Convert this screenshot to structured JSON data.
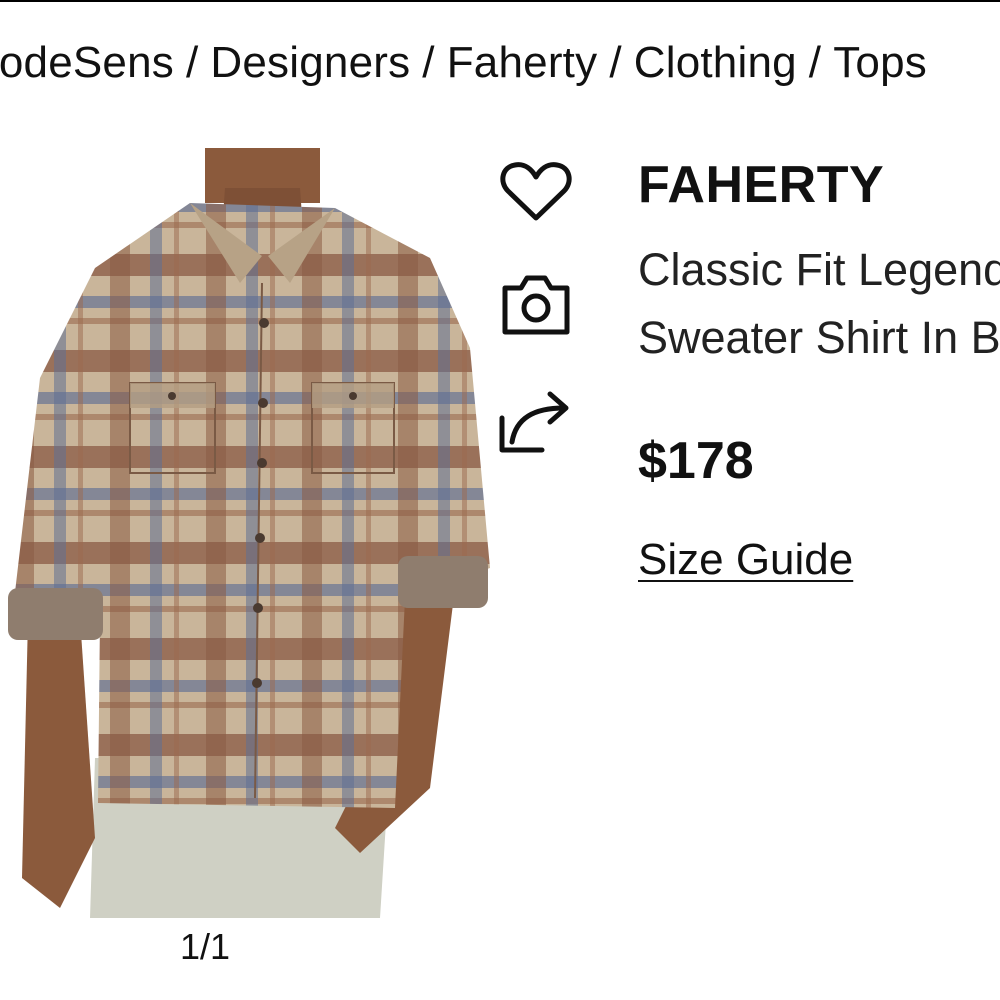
{
  "breadcrumb": {
    "items": [
      "ModeSens",
      "Designers",
      "Faherty",
      "Clothing",
      "Tops"
    ],
    "separator": "/"
  },
  "product": {
    "brand": "FAHERTY",
    "name_line1": "Classic Fit Legend",
    "name_line2": "Sweater Shirt In B",
    "price": "$178",
    "size_guide": "Size Guide",
    "image_counter": "1/1"
  },
  "actions": {
    "icons": [
      "heart-icon",
      "camera-icon",
      "share-icon"
    ]
  },
  "colors": {
    "text": "#111111",
    "shirt_tan": "#c9b59a",
    "shirt_brown": "#8a5a44",
    "shirt_blue": "#5f6f93",
    "pants": "#cfd0c4",
    "skin": "#8b5a3c"
  }
}
